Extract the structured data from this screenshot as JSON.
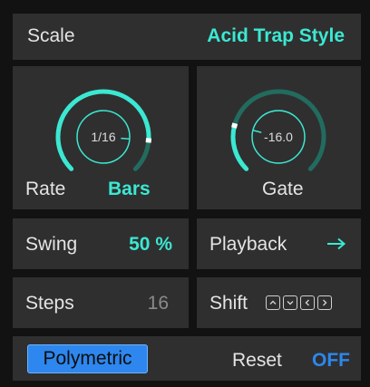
{
  "scale": {
    "label": "Scale",
    "value": "Acid Trap Style"
  },
  "rate": {
    "knob_value": "1/16",
    "label": "Rate",
    "mode": "Bars",
    "level": 0.85
  },
  "gate": {
    "knob_value": "-16.0",
    "label": "Gate",
    "level": 0.22
  },
  "swing": {
    "label": "Swing",
    "value": "50 %"
  },
  "playback": {
    "label": "Playback",
    "direction_icon": "arrow-right-icon"
  },
  "steps": {
    "label": "Steps",
    "value": "16"
  },
  "shift": {
    "label": "Shift",
    "buttons": [
      "chevron-up-icon",
      "chevron-down-icon",
      "chevron-left-icon",
      "chevron-right-icon"
    ]
  },
  "footer": {
    "polymetric_label": "Polymetric",
    "reset_label": "Reset",
    "reset_value": "OFF"
  },
  "colors": {
    "accent": "#3be8d2",
    "knob_track": "#226b5f",
    "panel": "#2f2f2f",
    "background": "#121212",
    "polymetric_button": "#2d87ee",
    "off_value": "#2d87ee"
  }
}
